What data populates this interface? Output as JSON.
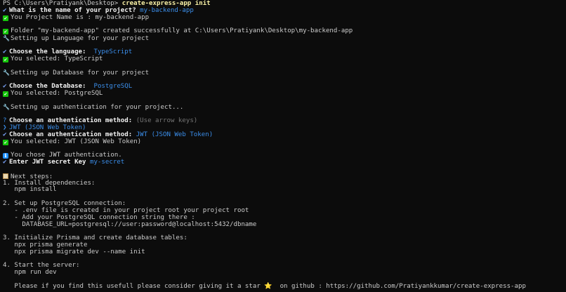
{
  "prompt": {
    "path": "PS C:\\Users\\Pratiyank\\Desktop> ",
    "command": "create-express-app init"
  },
  "icons": {
    "check_mark": "✔",
    "ok_box": "✔",
    "wrench": "🔧",
    "question": "?",
    "pointer": "❯",
    "info": "ℹ",
    "clipboard": "clipboard-icon",
    "star": "⭐"
  },
  "q_project": {
    "label": "What is the name of your project?",
    "answer": "my-backend-app"
  },
  "project_name": "You Project Name is : my-backend-app",
  "folder_created": "Folder \"my-backend-app\" created successfully at C:\\Users\\Pratiyank\\Desktop\\my-backend-app",
  "setup_lang": "Setting up Language for your project",
  "q_lang": {
    "label": "Choose the language: ",
    "answer": "TypeScript"
  },
  "lang_selected": "You selected: TypeScript",
  "setup_db": "Setting up Database for your project",
  "q_db": {
    "label": "Choose the Database: ",
    "answer": "PostgreSQL"
  },
  "db_selected": "You selected: PostgreSQL",
  "setup_auth": "Setting up authentication for your project...",
  "q_auth_open": {
    "label": "Choose an authentication method:",
    "hint": "(Use arrow keys)"
  },
  "auth_option": "JWT (JSON Web Token)",
  "q_auth_done": {
    "label": "Choose an authentication method:",
    "answer": "JWT (JSON Web Token)"
  },
  "auth_selected": "You selected: JWT (JSON Web Token)",
  "chose_jwt": "You chose JWT authentication.",
  "q_secret": {
    "label": "Enter JWT secret Key",
    "answer": "my-secret"
  },
  "next_steps": {
    "title": "Next steps:",
    "lines": [
      "1. Install dependencies:",
      "   npm install",
      "",
      "2. Set up PostgreSQL connection:",
      "   - .env file is created in your project root your project root",
      "   - Add your PostgreSQL connection string there :",
      "     DATABASE_URL=postgresql://user:password@localhost:5432/dbname",
      "",
      "3. Initialize Prisma and create database tables:",
      "   npx prisma generate",
      "   npx prisma migrate dev --name init",
      "",
      "4. Start the server:",
      "   npm run dev",
      ""
    ]
  },
  "footer": "   Please if you find this usefull please consider giving it a star ⭐  on github : https://github.com/Pratiyankkumar/create-express-app"
}
